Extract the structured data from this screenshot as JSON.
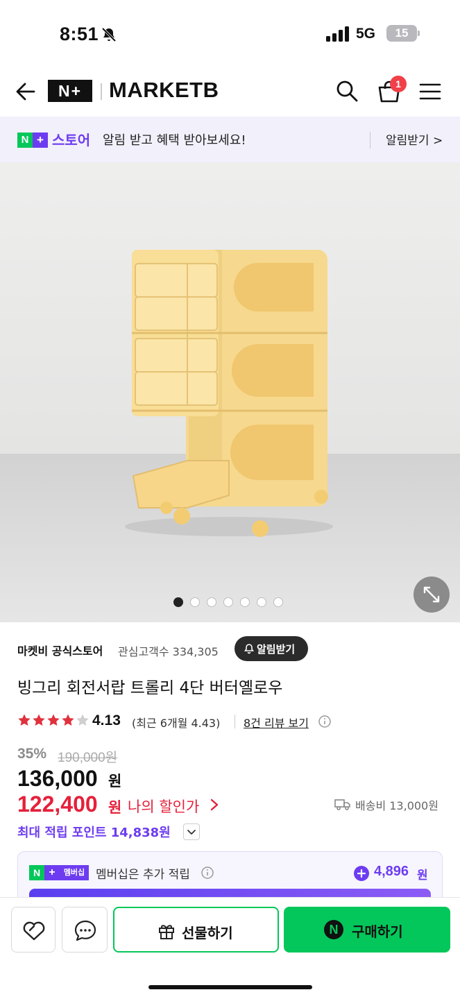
{
  "status_bar": {
    "time": "8:51",
    "network": "5G",
    "battery": "15"
  },
  "header": {
    "np_logo": "N+",
    "brand": "MARKETB",
    "cart_count": "1"
  },
  "banner": {
    "badge_n": "N",
    "badge_plus": "+",
    "store": "스토어",
    "message": "알림 받고 혜택 받아보세요!",
    "link": "알림받기 >"
  },
  "gallery": {
    "total_images": 7,
    "current_index": 1
  },
  "product": {
    "store_name": "마켓비 공식스토어",
    "fans": "관심고객수 334,305",
    "alert_button": "알림받기",
    "title": "빙그리 회전서랍 트롤리 4단 버터옐로우",
    "stars_filled": 4,
    "rating": "4.13",
    "recent_rating": "(최근 6개월 4.43)",
    "review_link": "8건 리뷰 보기",
    "discount": "35%",
    "original_price": "190,000원",
    "price": "136,000",
    "price_unit": "원",
    "my_price": "122,400",
    "my_price_unit": "원",
    "my_price_label": "나의 할인가",
    "shipping": "배송비 13,000원",
    "points": "최대 적립 포인트 14,838원",
    "membership_badge_n": "N",
    "membership_badge_plus": "+",
    "membership_badge": "멤버십",
    "membership_text": "멤버십은 추가 적립",
    "membership_points": "4,896",
    "membership_points_unit": "원"
  },
  "actions": {
    "gift": "선물하기",
    "buy": "구매하기",
    "buy_icon": "N"
  },
  "colors": {
    "naver_green": "#03c75a",
    "purple": "#6d3cf0",
    "sale_red": "#e5203a",
    "star_red": "#e0313d"
  },
  "icons": [
    "back-arrow-icon",
    "search-icon",
    "cart-icon",
    "menu-icon",
    "bell-off-icon",
    "expand-icon",
    "heart-icon",
    "chat-icon",
    "gift-icon",
    "truck-icon",
    "info-icon",
    "chevron-down-icon"
  ]
}
